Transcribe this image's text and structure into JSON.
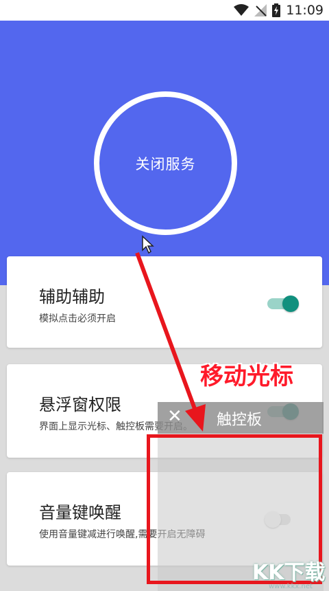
{
  "status_bar": {
    "time": "11:09",
    "icons": [
      "wifi-icon",
      "no-signal-icon",
      "battery-charging-icon"
    ]
  },
  "header": {
    "service_button_label": "关闭服务",
    "bg_color": "#5367ee"
  },
  "settings": [
    {
      "title": "辅助辅助",
      "subtitle": "模拟点击必须开启",
      "toggle_on": true
    },
    {
      "title": "悬浮窗权限",
      "subtitle": "界面上显示光标、触控板需要开启。",
      "toggle_on": true
    },
    {
      "title": "音量键唤醒",
      "subtitle": "使用音量键减进行唤醒,需要开启无障碍",
      "toggle_on": false
    }
  ],
  "touchpad": {
    "close_label": "✕",
    "title": "触控板"
  },
  "annotation": {
    "text": "移动光标",
    "color": "#e8161d"
  },
  "watermark": {
    "text": "KK下载",
    "url": "www.kkx.net"
  }
}
